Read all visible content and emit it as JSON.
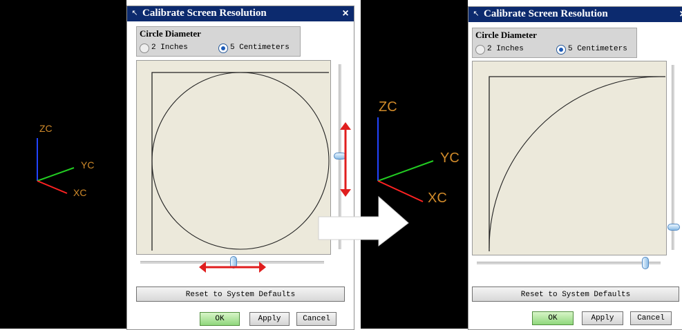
{
  "dialog": {
    "title": "Calibrate Screen Resolution",
    "group_title": "Circle Diameter",
    "options": [
      "2 Inches",
      "5 Centimeters"
    ],
    "selected": "5 Centimeters",
    "reset_label": "Reset to System Defaults",
    "ok_label": "OK",
    "apply_label": "Apply",
    "cancel_label": "Cancel",
    "close_symbol": "×"
  },
  "axes": {
    "zc": "ZC",
    "yc": "YC",
    "xc": "XC"
  },
  "colors": {
    "titlebar": "#0c2a6e",
    "viewport": "#000000",
    "axis_label": "#d08a2a",
    "axis_z": "#2244ff",
    "axis_y": "#22cc22",
    "axis_x": "#ff2222",
    "annotation_arrow": "#e01e1e",
    "canvas": "#ece9db",
    "ok_button": "#8fd77c"
  },
  "icons": [
    "pin-icon",
    "close-icon",
    "radio-icon",
    "slider-thumb-icon",
    "double-arrow-icon",
    "right-arrow-icon"
  ]
}
